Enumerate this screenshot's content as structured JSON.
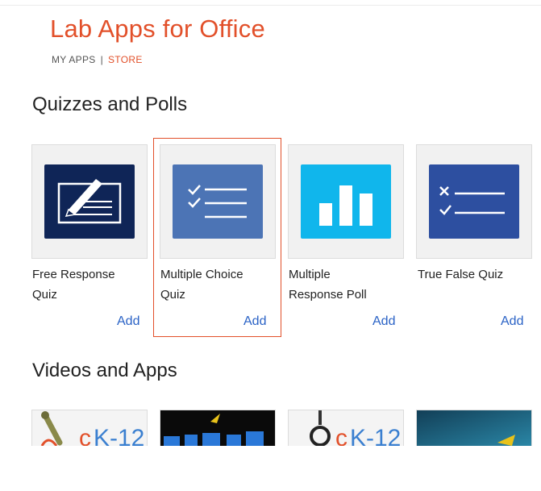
{
  "header": {
    "title": "Lab Apps for Office",
    "nav": {
      "my_apps": "MY APPS",
      "separator": "|",
      "store": "STORE"
    }
  },
  "sections": {
    "quizzes": {
      "title": "Quizzes and Polls"
    },
    "videos": {
      "title": "Videos and Apps"
    }
  },
  "apps": [
    {
      "name_line1": "Free Response",
      "name_line2": "Quiz",
      "add": "Add",
      "icon": "pencil-form-icon",
      "color": "#0f2557"
    },
    {
      "name_line1": "Multiple Choice",
      "name_line2": "Quiz",
      "add": "Add",
      "icon": "checklist-icon",
      "color": "#4c74b5",
      "selected": true
    },
    {
      "name_line1": "Multiple",
      "name_line2": "Response Poll",
      "add": "Add",
      "icon": "bar-chart-icon",
      "color": "#10b6ec"
    },
    {
      "name_line1": "True False Quiz",
      "name_line2": "",
      "add": "Add",
      "icon": "true-false-icon",
      "color": "#2d4fa0"
    }
  ],
  "videos": [
    {
      "icon": "ck12-logo-icon",
      "logo_text": "CK-12"
    },
    {
      "icon": "blendspace-logo-icon",
      "logo_text": ""
    },
    {
      "icon": "ck12-logo-icon",
      "logo_text": "CK-12"
    },
    {
      "icon": "video-thumbnail-icon",
      "logo_text": ""
    }
  ],
  "colors": {
    "accent": "#e2502a",
    "link": "#2b63c6"
  }
}
